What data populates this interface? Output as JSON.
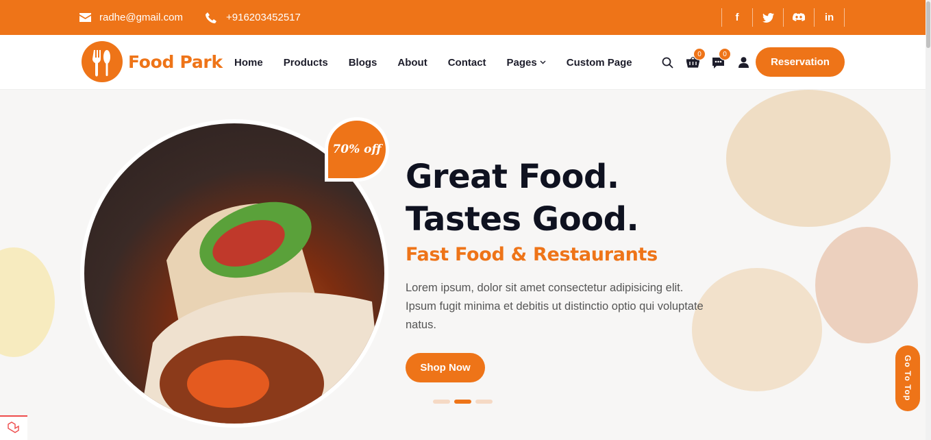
{
  "topbar": {
    "email": "radhe@gmail.com",
    "phone": "+916203452517",
    "social": [
      {
        "icon": "facebook-icon",
        "label": "f"
      },
      {
        "icon": "twitter-icon",
        "label": ""
      },
      {
        "icon": "discord-icon",
        "label": ""
      },
      {
        "icon": "linkedin-icon",
        "label": "in"
      }
    ]
  },
  "brand": {
    "name": "Food Park",
    "color": "#ee7418"
  },
  "nav": {
    "items": [
      "Home",
      "Products",
      "Blogs",
      "About",
      "Contact",
      "Pages",
      "Custom Page"
    ],
    "cart_count": "0",
    "message_count": "0",
    "reservation_label": "Reservation"
  },
  "hero": {
    "discount": "70% off",
    "title": "Great Food. Tastes Good.",
    "subtitle": "Fast Food & Restaurants",
    "description": "Lorem ipsum, dolor sit amet consectetur adipisicing elit. Ipsum fugit minima et debitis ut distinctio optio qui voluptate natus.",
    "cta_label": "Shop Now",
    "slide_count": 3,
    "active_slide": 2
  },
  "go_to_top_label": "Go To Top"
}
